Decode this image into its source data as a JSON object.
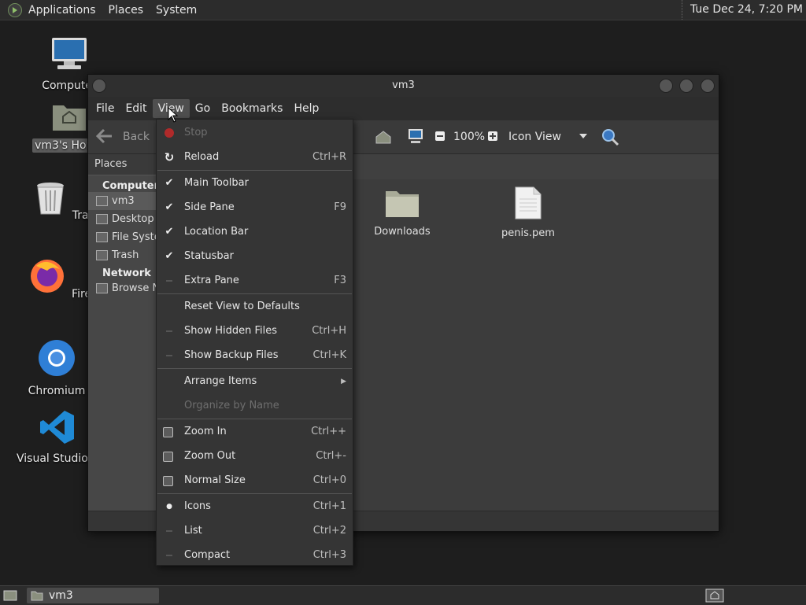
{
  "top_panel": {
    "menus": [
      "Applications",
      "Places",
      "System"
    ],
    "clock": "Tue Dec 24,  7:20 PM"
  },
  "desktop": {
    "icons": [
      {
        "label": "Computer",
        "icon": "computer-icon"
      },
      {
        "label": "vm3's Home",
        "icon": "home-folder-icon"
      },
      {
        "label": "Trash",
        "icon": "trash-icon"
      },
      {
        "label": "Firefox",
        "icon": "firefox-icon"
      },
      {
        "label": "Chromium",
        "icon": "chromium-icon"
      },
      {
        "label": "Visual Studio Code",
        "icon": "vscode-icon"
      }
    ]
  },
  "window": {
    "title": "vm3",
    "menubar": [
      "File",
      "Edit",
      "View",
      "Go",
      "Bookmarks",
      "Help"
    ],
    "toolbar": {
      "back_label": "Back",
      "zoom": "100%",
      "view_mode": "Icon View"
    },
    "sidepane": {
      "header": "Places",
      "groups": [
        {
          "name": "Computer",
          "items": [
            "vm3",
            "Desktop",
            "File System",
            "Trash"
          ]
        },
        {
          "name": "Network",
          "items": [
            "Browse Network"
          ]
        }
      ]
    },
    "files": [
      {
        "name": "Downloads",
        "icon": "folder-icon"
      },
      {
        "name": "penis.pem",
        "icon": "document-icon"
      }
    ]
  },
  "view_menu": {
    "items": [
      {
        "label": "Stop",
        "accel": "",
        "mark": "stop-icon",
        "disabled": true
      },
      {
        "label": "Reload",
        "accel": "Ctrl+R",
        "mark": "reload-icon"
      },
      {
        "label": "Main Toolbar",
        "accel": "",
        "mark": "check"
      },
      {
        "label": "Side Pane",
        "accel": "F9",
        "mark": "check"
      },
      {
        "label": "Location Bar",
        "accel": "",
        "mark": "check"
      },
      {
        "label": "Statusbar",
        "accel": "",
        "mark": "check"
      },
      {
        "label": "Extra Pane",
        "accel": "F3",
        "mark": "unchecked"
      },
      {
        "label": "Reset View to Defaults",
        "accel": "",
        "mark": "none"
      },
      {
        "label": "Show Hidden Files",
        "accel": "Ctrl+H",
        "mark": "unchecked"
      },
      {
        "label": "Show Backup Files",
        "accel": "Ctrl+K",
        "mark": "unchecked"
      },
      {
        "label": "Arrange Items",
        "accel": "",
        "mark": "submenu"
      },
      {
        "label": "Organize by Name",
        "accel": "",
        "mark": "none",
        "disabled": true
      },
      {
        "label": "Zoom In",
        "accel": "Ctrl++",
        "mark": "zoom-in-icon"
      },
      {
        "label": "Zoom Out",
        "accel": "Ctrl+-",
        "mark": "zoom-out-icon"
      },
      {
        "label": "Normal Size",
        "accel": "Ctrl+0",
        "mark": "zoom-normal-icon"
      },
      {
        "label": "Icons",
        "accel": "Ctrl+1",
        "mark": "radio-on"
      },
      {
        "label": "List",
        "accel": "Ctrl+2",
        "mark": "radio-off"
      },
      {
        "label": "Compact",
        "accel": "Ctrl+3",
        "mark": "radio-off"
      }
    ]
  },
  "bottom_panel": {
    "task_label": "vm3"
  }
}
